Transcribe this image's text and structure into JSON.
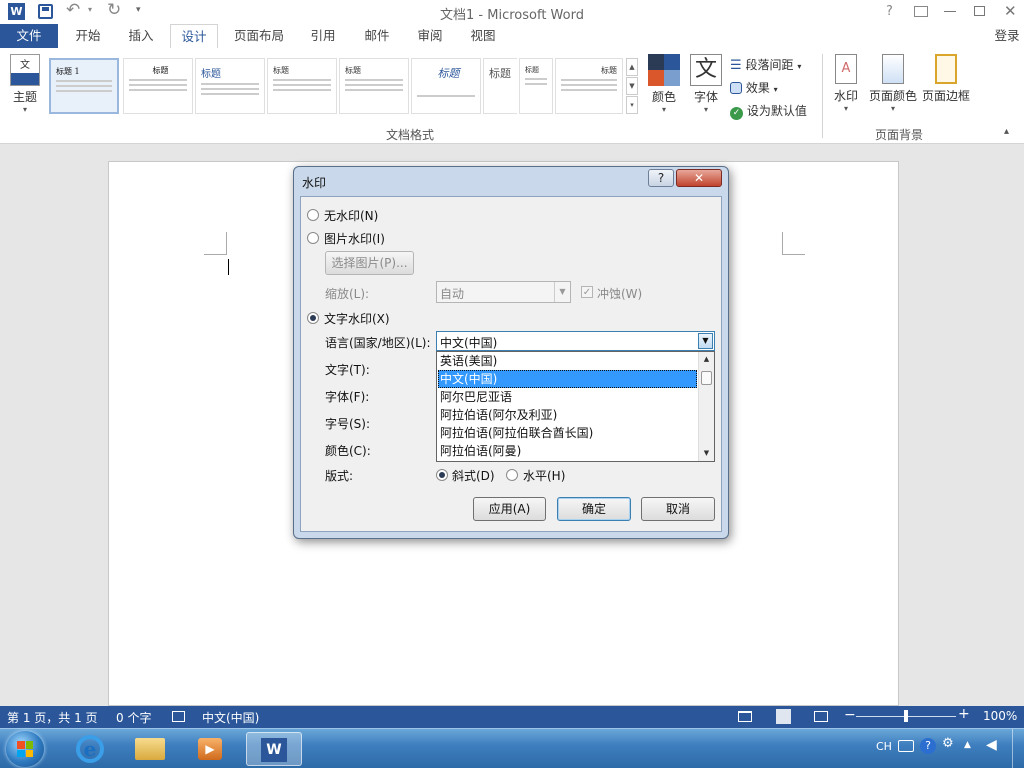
{
  "window": {
    "title": "文档1 - Microsoft Word",
    "help": "?",
    "login": "登录"
  },
  "tabs": [
    {
      "label": "文件"
    },
    {
      "label": "开始"
    },
    {
      "label": "插入"
    },
    {
      "label": "设计"
    },
    {
      "label": "页面布局"
    },
    {
      "label": "引用"
    },
    {
      "label": "邮件"
    },
    {
      "label": "审阅"
    },
    {
      "label": "视图"
    }
  ],
  "ribbon": {
    "theme_label": "主题",
    "style_gallery": [
      "标题 1",
      "标题",
      "标题",
      "标题",
      "标题",
      "标题",
      "标题",
      "标题",
      "标题"
    ],
    "colors_label": "颜色",
    "fonts_label": "字体",
    "fonts_glyph": "文",
    "paragraph_spacing": "段落间距",
    "effects": "效果",
    "set_default": "设为默认值",
    "group_doc_format": "文档格式",
    "watermark_label": "水印",
    "page_color_label": "页面颜色",
    "page_border_label": "页面边框",
    "group_page_bg": "页面背景"
  },
  "dialog": {
    "title": "水印",
    "help": "?",
    "no_watermark": "无水印(N)",
    "picture_watermark": "图片水印(I)",
    "select_picture": "选择图片(P)...",
    "scale_label": "缩放(L):",
    "scale_value": "自动",
    "washout_label": "冲蚀(W)",
    "text_watermark": "文字水印(X)",
    "language_label": "语言(国家/地区)(L):",
    "language_value": "中文(中国)",
    "text_label": "文字(T):",
    "font_label": "字体(F):",
    "size_label": "字号(S):",
    "color_label": "颜色(C):",
    "layout_label": "版式:",
    "diagonal": "斜式(D)",
    "horizontal": "水平(H)",
    "apply": "应用(A)",
    "ok": "确定",
    "cancel": "取消",
    "language_options": [
      "英语(美国)",
      "中文(中国)",
      "阿尔巴尼亚语",
      "阿拉伯语(阿尔及利亚)",
      "阿拉伯语(阿拉伯联合酋长国)",
      "阿拉伯语(阿曼)"
    ],
    "selected_index": 1
  },
  "statusbar": {
    "page": "第 1 页，共 1 页",
    "words": "0 个字",
    "language": "中文(中国)",
    "zoom": "100%",
    "zoom_level": 1.0
  },
  "taskbar": {
    "ime": "CH"
  },
  "colors": {
    "accent": "#2b579a",
    "selection": "#3399ff",
    "taskbar": "#3f7fbf"
  }
}
